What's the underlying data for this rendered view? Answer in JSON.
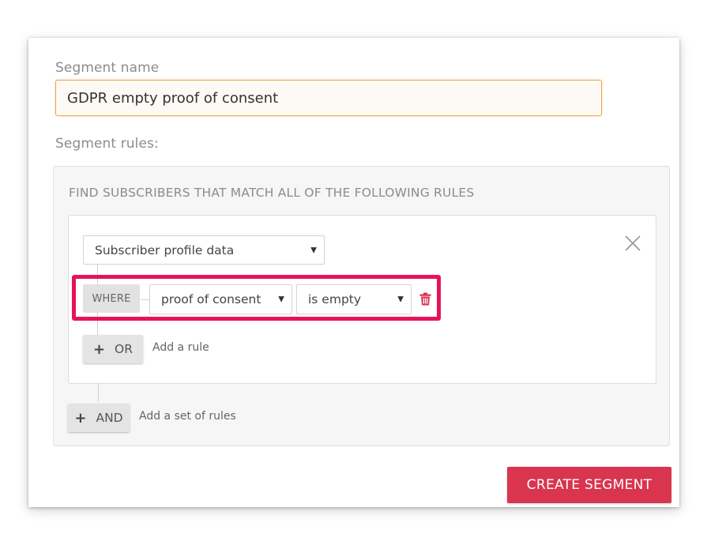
{
  "segment_name": {
    "label": "Segment name",
    "value": "GDPR empty proof of consent"
  },
  "segment_rules": {
    "label": "Segment rules:",
    "heading": "FIND SUBSCRIBERS THAT MATCH ALL OF THE FOLLOWING RULES",
    "rule_set": {
      "source_select": "Subscriber profile data",
      "rule": {
        "where_label": "WHERE",
        "field_select": "proof of consent",
        "operator_select": "is empty"
      },
      "add_or": {
        "button_label": "OR",
        "hint": "Add a rule"
      }
    },
    "add_and": {
      "button_label": "AND",
      "hint": "Add a set of rules"
    }
  },
  "actions": {
    "create_label": "CREATE SEGMENT"
  },
  "colors": {
    "accent": "#d9354f",
    "highlight": "#e8125c",
    "input_focus": "#f0a24c",
    "delete_icon": "#d9354f"
  },
  "icons": {
    "close": "close-icon",
    "delete": "trash-icon",
    "dropdown": "chevron-down-icon",
    "plus": "plus-icon"
  }
}
